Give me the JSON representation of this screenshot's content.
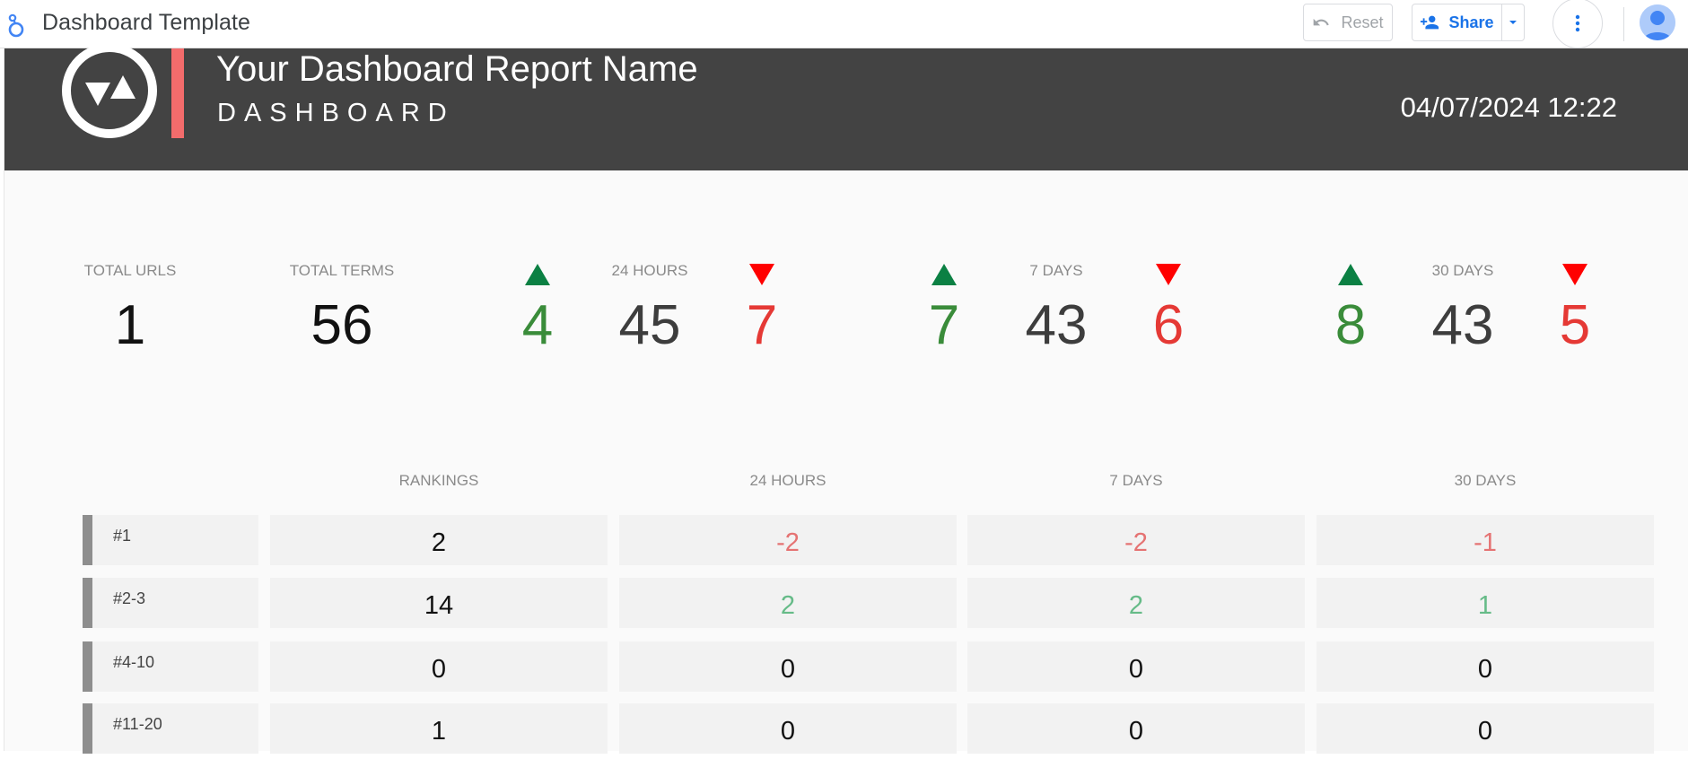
{
  "app": {
    "document_title": "Dashboard Template",
    "reset_label": "Reset",
    "share_label": "Share"
  },
  "report": {
    "title": "Your Dashboard Report Name",
    "subtitle": "DASHBOARD",
    "datetime": "04/07/2024 12:22",
    "accent_color": "#f36c6c",
    "header_color": "#434343"
  },
  "kpis": {
    "total_urls": {
      "label": "TOTAL URLS",
      "value": "1"
    },
    "total_terms": {
      "label": "TOTAL TERMS",
      "value": "56"
    },
    "periods": [
      {
        "label": "24 HOURS",
        "value": "45",
        "up": "4",
        "down": "7"
      },
      {
        "label": "7 DAYS",
        "value": "43",
        "up": "7",
        "down": "6"
      },
      {
        "label": "30 DAYS",
        "value": "43",
        "up": "8",
        "down": "5"
      }
    ],
    "up_color": "#0b8043",
    "down_color": "#ff0000"
  },
  "rankings": {
    "columns": [
      "RANKINGS",
      "24 HOURS",
      "7 DAYS",
      "30 DAYS"
    ],
    "rows": [
      {
        "label": "#1",
        "values": [
          "2",
          "-2",
          "-2",
          "-1"
        ]
      },
      {
        "label": "#2-3",
        "values": [
          "14",
          "2",
          "2",
          "1"
        ]
      },
      {
        "label": "#4-10",
        "values": [
          "0",
          "0",
          "0",
          "0"
        ]
      },
      {
        "label": "#11-20",
        "values": [
          "1",
          "0",
          "0",
          "0"
        ]
      }
    ]
  }
}
